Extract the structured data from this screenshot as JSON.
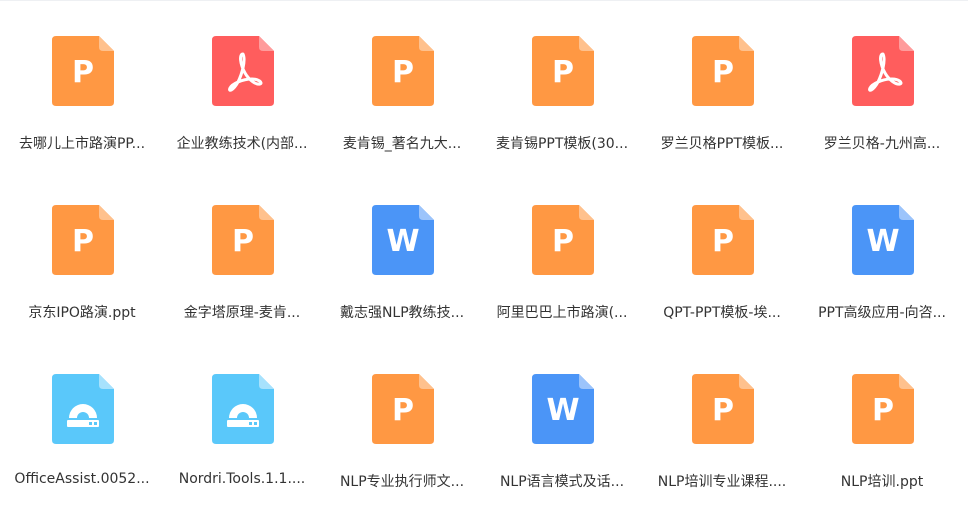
{
  "files": [
    {
      "name": "去哪儿上市路演PP...",
      "type": "ppt"
    },
    {
      "name": "企业教练技术(内部...",
      "type": "pdf"
    },
    {
      "name": "麦肯锡_著名九大...",
      "type": "ppt"
    },
    {
      "name": "麦肯锡PPT模板(30...",
      "type": "ppt"
    },
    {
      "name": "罗兰贝格PPT模板...",
      "type": "ppt"
    },
    {
      "name": "罗兰贝格-九州高...",
      "type": "pdf"
    },
    {
      "name": "京东IPO路演.ppt",
      "type": "ppt"
    },
    {
      "name": "金字塔原理-麦肯...",
      "type": "ppt"
    },
    {
      "name": "戴志强NLP教练技...",
      "type": "word"
    },
    {
      "name": "阿里巴巴上市路演(...",
      "type": "ppt"
    },
    {
      "name": "QPT-PPT模板-埃...",
      "type": "ppt"
    },
    {
      "name": "PPT高级应用-向咨...",
      "type": "word"
    },
    {
      "name": "OfficeAssist.0052...",
      "type": "installer"
    },
    {
      "name": "Nordri.Tools.1.1....",
      "type": "installer"
    },
    {
      "name": "NLP专业执行师文...",
      "type": "ppt"
    },
    {
      "name": "NLP语言模式及话...",
      "type": "word"
    },
    {
      "name": "NLP培训专业课程....",
      "type": "ppt"
    },
    {
      "name": "NLP培训.ppt",
      "type": "ppt"
    }
  ],
  "icon_types": {
    "ppt": {
      "icon": "ppt-file-icon",
      "letter": "P",
      "color": "#FF9843",
      "fold": "#FFC18D"
    },
    "pdf": {
      "icon": "pdf-file-icon",
      "letter": "",
      "color": "#FF5D5D",
      "fold": "#FF9C9C"
    },
    "word": {
      "icon": "word-file-icon",
      "letter": "W",
      "color": "#4B95F7",
      "fold": "#9CC4FB"
    },
    "installer": {
      "icon": "installer-file-icon",
      "letter": "",
      "color": "#5AC8FA",
      "fold": "#A7E2FD"
    }
  }
}
